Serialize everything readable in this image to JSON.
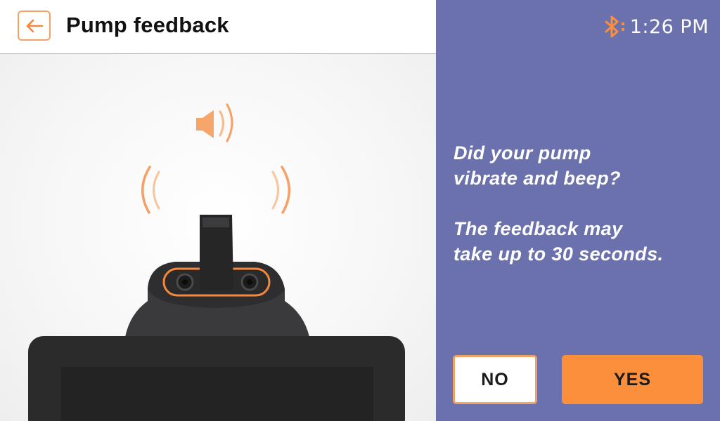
{
  "header": {
    "title": "Pump feedback",
    "back_icon": "arrow-left-icon"
  },
  "status": {
    "time": "1:26 PM",
    "bluetooth_icon": "bluetooth-icon"
  },
  "prompt": {
    "question": "Did your pump\nvibrate and beep?",
    "note": "The feedback may\ntake up to 30 seconds."
  },
  "actions": {
    "no_label": "NO",
    "yes_label": "YES"
  },
  "colors": {
    "accent": "#fb8f3c",
    "panel": "#6b71ad"
  }
}
